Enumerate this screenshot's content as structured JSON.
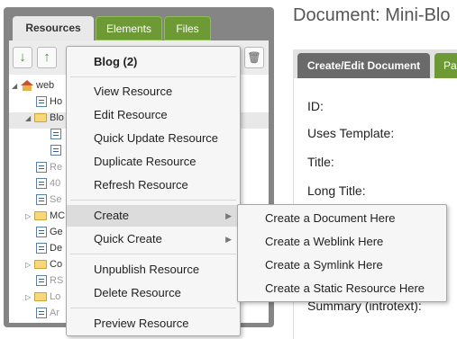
{
  "left_tabs": {
    "resources": "Resources",
    "elements": "Elements",
    "files": "Files"
  },
  "tree": [
    {
      "label": "web"
    },
    {
      "label": "Ho"
    },
    {
      "label": "Blo"
    },
    {
      "label": ""
    },
    {
      "label": ""
    },
    {
      "label": "Re"
    },
    {
      "label": "40"
    },
    {
      "label": "Se"
    },
    {
      "label": "MC"
    },
    {
      "label": "Ge"
    },
    {
      "label": "De"
    },
    {
      "label": "Co"
    },
    {
      "label": "RS"
    },
    {
      "label": "Lo"
    },
    {
      "label": "Ar"
    }
  ],
  "document": {
    "title": "Document: Mini-Blo"
  },
  "right_tabs": {
    "create_edit": "Create/Edit Document",
    "page": "Pa"
  },
  "fields": {
    "id": "ID:",
    "uses_template": "Uses Template:",
    "title": "Title:",
    "long_title": "Long Title:",
    "summary": "Summary (introtext):"
  },
  "context_menu": {
    "header": "Blog (2)",
    "view": "View Resource",
    "edit": "Edit Resource",
    "quick_update": "Quick Update Resource",
    "duplicate": "Duplicate Resource",
    "refresh": "Refresh Resource",
    "create": "Create",
    "quick_create": "Quick Create",
    "unpublish": "Unpublish Resource",
    "delete": "Delete Resource",
    "preview": "Preview Resource"
  },
  "create_submenu": {
    "document": "Create a Document Here",
    "weblink": "Create a Weblink Here",
    "symlink": "Create a Symlink Here",
    "static": "Create a Static Resource Here"
  }
}
